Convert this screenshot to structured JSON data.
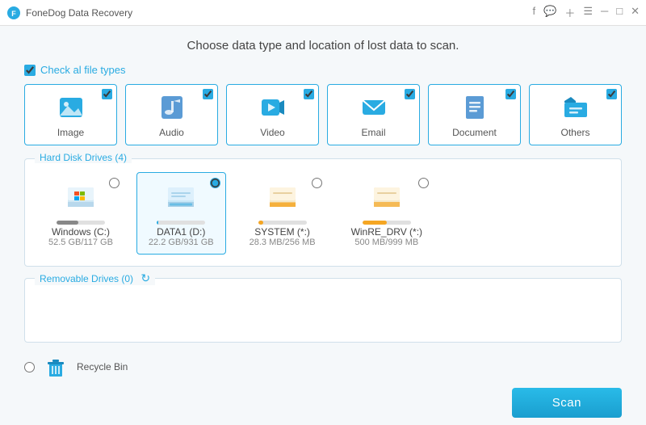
{
  "titlebar": {
    "title": "FoneDog Data Recovery",
    "icons": [
      "facebook",
      "chat",
      "plus",
      "menu",
      "minimize",
      "maximize",
      "close"
    ]
  },
  "page": {
    "title": "Choose data type and location of lost data to scan."
  },
  "check_all": {
    "label": "Check al file types",
    "checked": true
  },
  "file_types": [
    {
      "id": "image",
      "label": "Image",
      "checked": true
    },
    {
      "id": "audio",
      "label": "Audio",
      "checked": true
    },
    {
      "id": "video",
      "label": "Video",
      "checked": true
    },
    {
      "id": "email",
      "label": "Email",
      "checked": true
    },
    {
      "id": "document",
      "label": "Document",
      "checked": true
    },
    {
      "id": "others",
      "label": "Others",
      "checked": true
    }
  ],
  "hard_disk": {
    "section_title": "Hard Disk Drives (4)",
    "drives": [
      {
        "id": "c",
        "name": "Windows (C:)",
        "size": "52.5 GB/117 GB",
        "selected": false,
        "bar_pct": 45,
        "bar_color": "#888888",
        "type": "windows"
      },
      {
        "id": "d",
        "name": "DATA1 (D:)",
        "size": "22.2 GB/931 GB",
        "selected": true,
        "bar_pct": 3,
        "bar_color": "#29abe2",
        "type": "data"
      },
      {
        "id": "s",
        "name": "SYSTEM (*:)",
        "size": "28.3 MB/256 MB",
        "selected": false,
        "bar_pct": 11,
        "bar_color": "#f5a623",
        "type": "system"
      },
      {
        "id": "w",
        "name": "WinRE_DRV (*:)",
        "size": "500 MB/999 MB",
        "selected": false,
        "bar_pct": 50,
        "bar_color": "#f5a623",
        "type": "winre"
      }
    ]
  },
  "removable": {
    "section_title": "Removable Drives (0)"
  },
  "recycle_bin": {
    "label": "Recycle Bin",
    "selected": false
  },
  "scan_button": {
    "label": "Scan"
  }
}
